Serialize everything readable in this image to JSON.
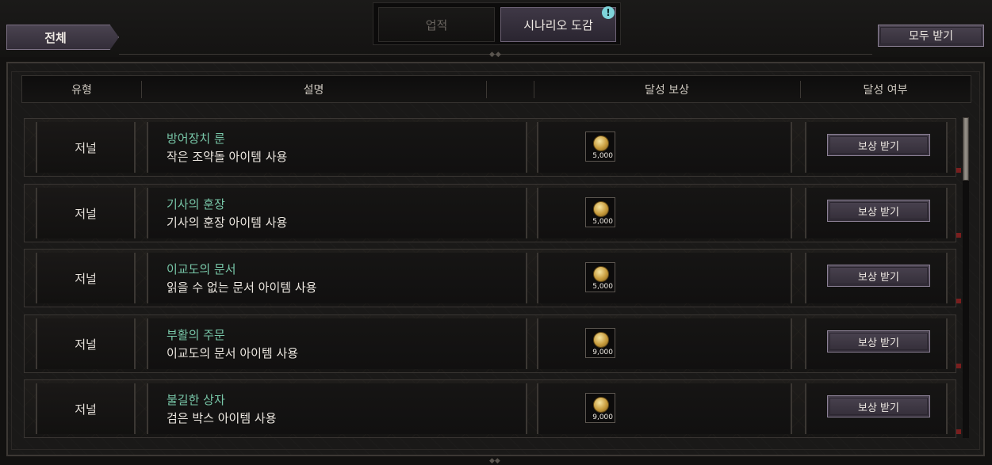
{
  "filter": {
    "label": "전체"
  },
  "tabs": [
    {
      "label": "업적",
      "active": false
    },
    {
      "label": "시나리오 도감",
      "active": true,
      "alert": "!"
    }
  ],
  "receive_all_label": "모두 받기",
  "columns": {
    "type": "유형",
    "desc": "설명",
    "reward": "달성 보상",
    "status": "달성 여부"
  },
  "rows": [
    {
      "type": "저널",
      "title": "방어장치 룬",
      "desc": "작은 조약돌 아이템 사용",
      "reward_amount": "5,000",
      "reward_icon": "gold-coin-icon",
      "button": "보상 받기"
    },
    {
      "type": "저널",
      "title": "기사의 훈장",
      "desc": "기사의 훈장 아이템 사용",
      "reward_amount": "5,000",
      "reward_icon": "gold-coin-icon",
      "button": "보상 받기"
    },
    {
      "type": "저널",
      "title": "이교도의 문서",
      "desc": "읽을 수 없는 문서 아이템 사용",
      "reward_amount": "5,000",
      "reward_icon": "gold-coin-icon",
      "button": "보상 받기"
    },
    {
      "type": "저널",
      "title": "부활의 주문",
      "desc": "이교도의 문서 아이템 사용",
      "reward_amount": "9,000",
      "reward_icon": "gold-coin-icon",
      "button": "보상 받기"
    },
    {
      "type": "저널",
      "title": "불길한 상자",
      "desc": "검은 박스 아이템 사용",
      "reward_amount": "9,000",
      "reward_icon": "gold-coin-icon",
      "button": "보상 받기"
    }
  ],
  "colors": {
    "accent_title": "#78c7a8",
    "button_bg": "#3f3846",
    "alert": "#7fd4da"
  }
}
